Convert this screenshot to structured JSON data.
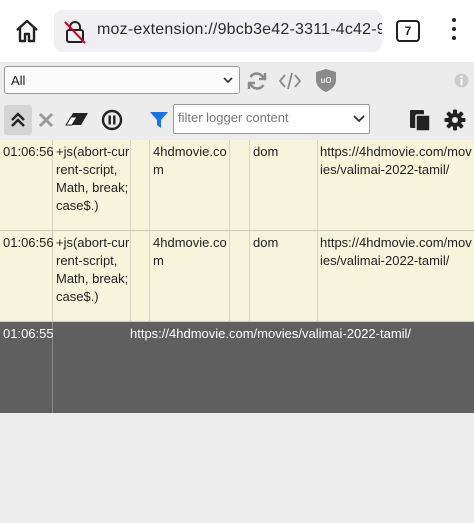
{
  "browser": {
    "url": "moz-extension://9bcb3e42-3311-4c42-98e",
    "tab_count": "7"
  },
  "toolbar1": {
    "tab_select_value": "All",
    "icons": [
      "refresh-icon",
      "code-icon",
      "ublock-icon",
      "info-icon"
    ]
  },
  "toolbar2": {
    "filter_placeholder": "filter logger content",
    "icons": [
      "collapse-icon",
      "clear-icon",
      "eraser-icon",
      "pause-icon",
      "funnel-icon",
      "copy-icon",
      "settings-icon"
    ]
  },
  "log": {
    "entries": [
      {
        "time": "01:06:56",
        "filter": "+js(abort-current-script, Math, break;case$.)",
        "context": "4hdmovie.com",
        "type": "dom",
        "url": "https://4hdmovie.com/movies/valimai-2022-tamil/"
      },
      {
        "time": "01:06:56",
        "filter": "+js(abort-current-script, Math, break;case$.)",
        "context": "4hdmovie.com",
        "type": "dom",
        "url": "https://4hdmovie.com/movies/valimai-2022-tamil/"
      }
    ],
    "document_entry": {
      "time": "01:06:55",
      "url": "https://4hdmovie.com/movies/valimai-2022-tamil/"
    }
  },
  "colors": {
    "entry_bg": "#f6f5dc",
    "document_bg": "#5f5f5f",
    "funnel_blue": "#1a73e8"
  }
}
